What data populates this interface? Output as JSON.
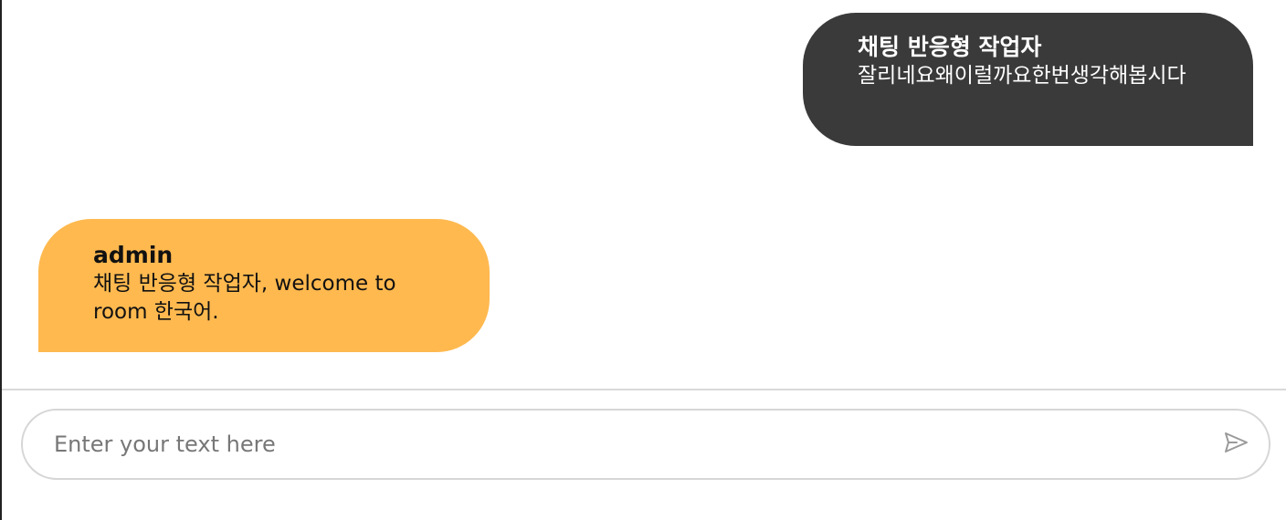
{
  "messages": [
    {
      "sender": "채팅 반응형 작업자",
      "text": "잘리네요왜이럴까요한번생각해봅시다",
      "direction": "outgoing",
      "color": "#3a3a3a"
    },
    {
      "sender": "admin",
      "text": "채팅 반응형 작업자, welcome to room 한국어.",
      "direction": "incoming",
      "color": "#ffb94f"
    }
  ],
  "composer": {
    "placeholder": "Enter your text here",
    "value": "",
    "send_icon": "send-icon"
  }
}
